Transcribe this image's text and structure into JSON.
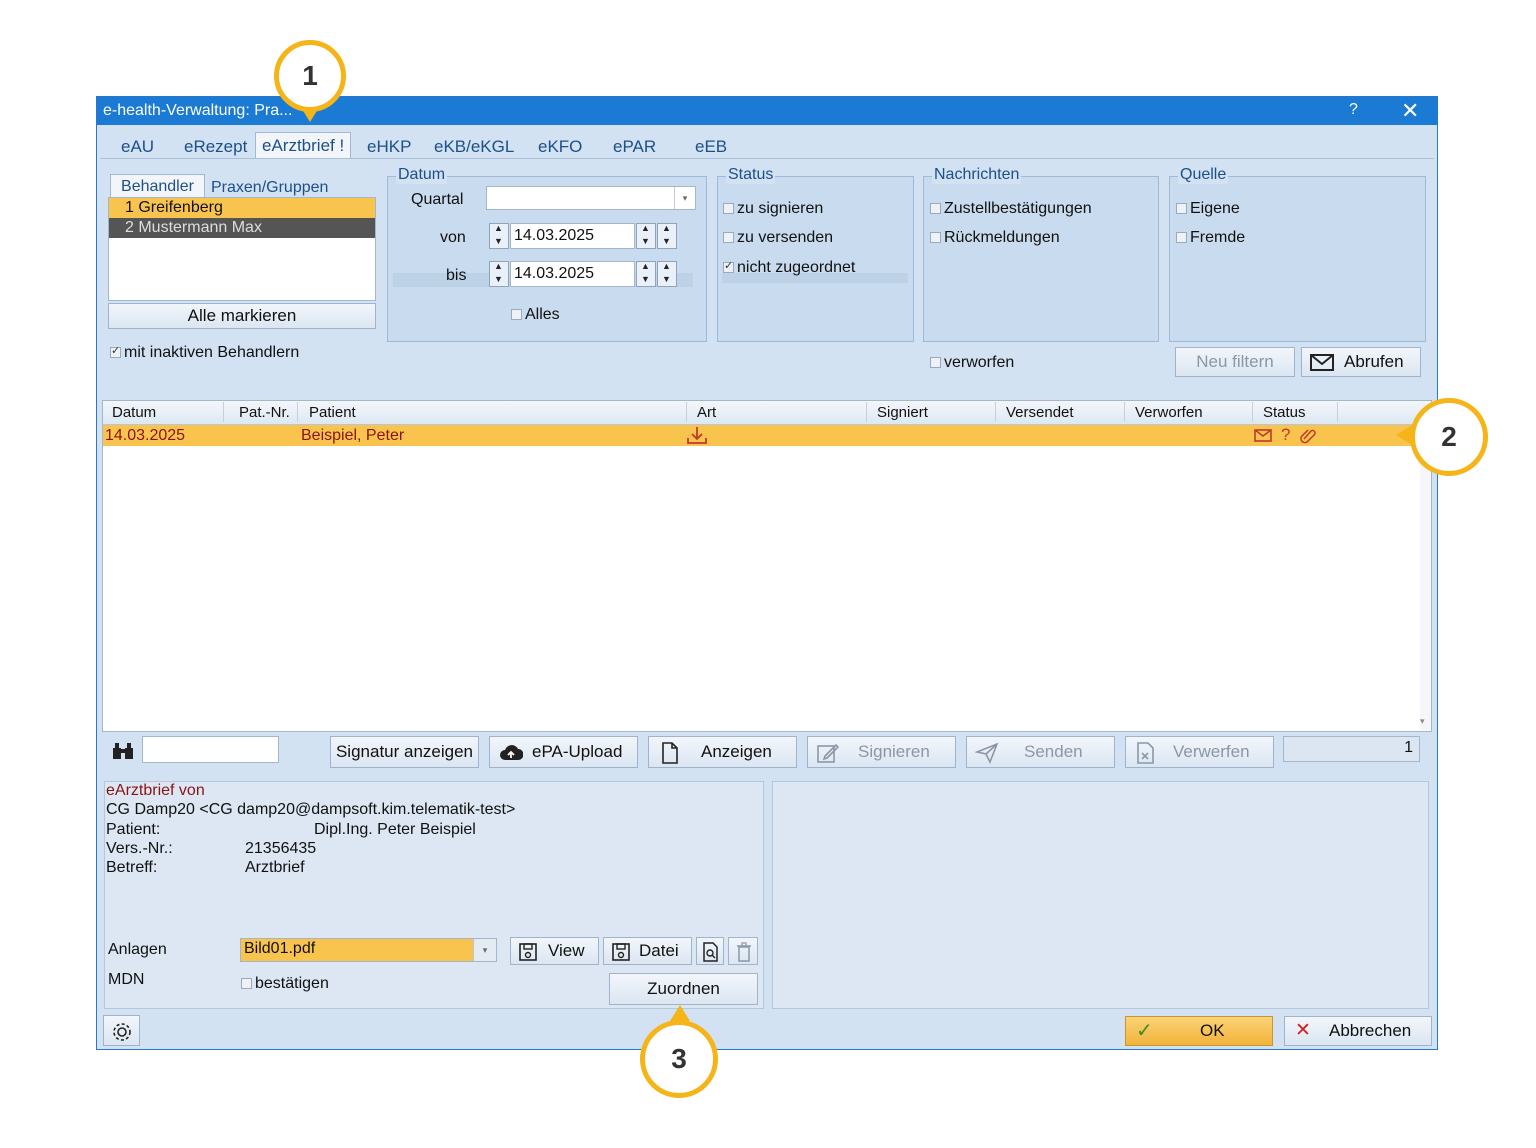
{
  "window": {
    "title": "e-health-Verwaltung: Pra...",
    "help": "?",
    "close": "✕"
  },
  "tabs": [
    "eAU",
    "eRezept",
    "eArztbrief !",
    "eHKP",
    "eKB/eKGL",
    "eKFO",
    "ePAR",
    "eEB"
  ],
  "behandler": {
    "tab1": "Behandler",
    "tab2": "Praxen/Gruppen",
    "items": [
      "1 Greifenberg",
      "2 Mustermann Max"
    ],
    "mark_all": "Alle markieren",
    "inactive": "mit inaktiven Behandlern"
  },
  "datum": {
    "legend": "Datum",
    "quartal_label": "Quartal",
    "quartal_value": "",
    "von_label": "von",
    "von_value": "14.03.2025",
    "bis_label": "bis",
    "bis_value": "14.03.2025",
    "alles": "Alles"
  },
  "status": {
    "legend": "Status",
    "zu_signieren": "zu signieren",
    "zu_versenden": "zu versenden",
    "nicht_zugeordnet": "nicht zugeordnet"
  },
  "nachrichten": {
    "legend": "Nachrichten",
    "zustell": "Zustellbestätigungen",
    "rueck": "Rückmeldungen",
    "verworfen": "verworfen"
  },
  "quelle": {
    "legend": "Quelle",
    "eigene": "Eigene",
    "fremde": "Fremde"
  },
  "buttons": {
    "neu_filtern": "Neu filtern",
    "abrufen": "Abrufen",
    "signatur": "Signatur anzeigen",
    "epa": "ePA-Upload",
    "anzeigen": "Anzeigen",
    "signieren": "Signieren",
    "senden": "Senden",
    "verwerfen": "Verwerfen",
    "view": "View",
    "datei": "Datei",
    "zuordnen": "Zuordnen",
    "ok": "OK",
    "abbrechen": "Abbrechen"
  },
  "table": {
    "headers": [
      "Datum",
      "Pat.-Nr.",
      "Patient",
      "Art",
      "Signiert",
      "Versendet",
      "Verworfen",
      "Status"
    ],
    "row": {
      "datum": "14.03.2025",
      "patnr": "",
      "patient": "Beispiel, Peter"
    },
    "status_icons": [
      "envelope-icon",
      "question-icon",
      "paperclip-icon"
    ]
  },
  "search": {
    "value": "",
    "count": "1"
  },
  "detail": {
    "heading": "eArztbrief von",
    "from": "CG Damp20 <CG damp20@dampsoft.kim.telematik-test>",
    "patient_label": "Patient:",
    "patient_value": "Dipl.Ing. Peter Beispiel",
    "vers_label": "Vers.-Nr.:",
    "vers_value": "21356435",
    "betreff_label": "Betreff:",
    "betreff_value": "Arztbrief",
    "anlagen_label": "Anlagen",
    "anlagen_value": "Bild01.pdf",
    "mdn_label": "MDN",
    "bestaetigen": "bestätigen"
  },
  "callouts": [
    "1",
    "2",
    "3"
  ],
  "colors": {
    "accent": "#1a7ad4",
    "highlight": "#f9c44e",
    "callout": "#f5b418"
  }
}
